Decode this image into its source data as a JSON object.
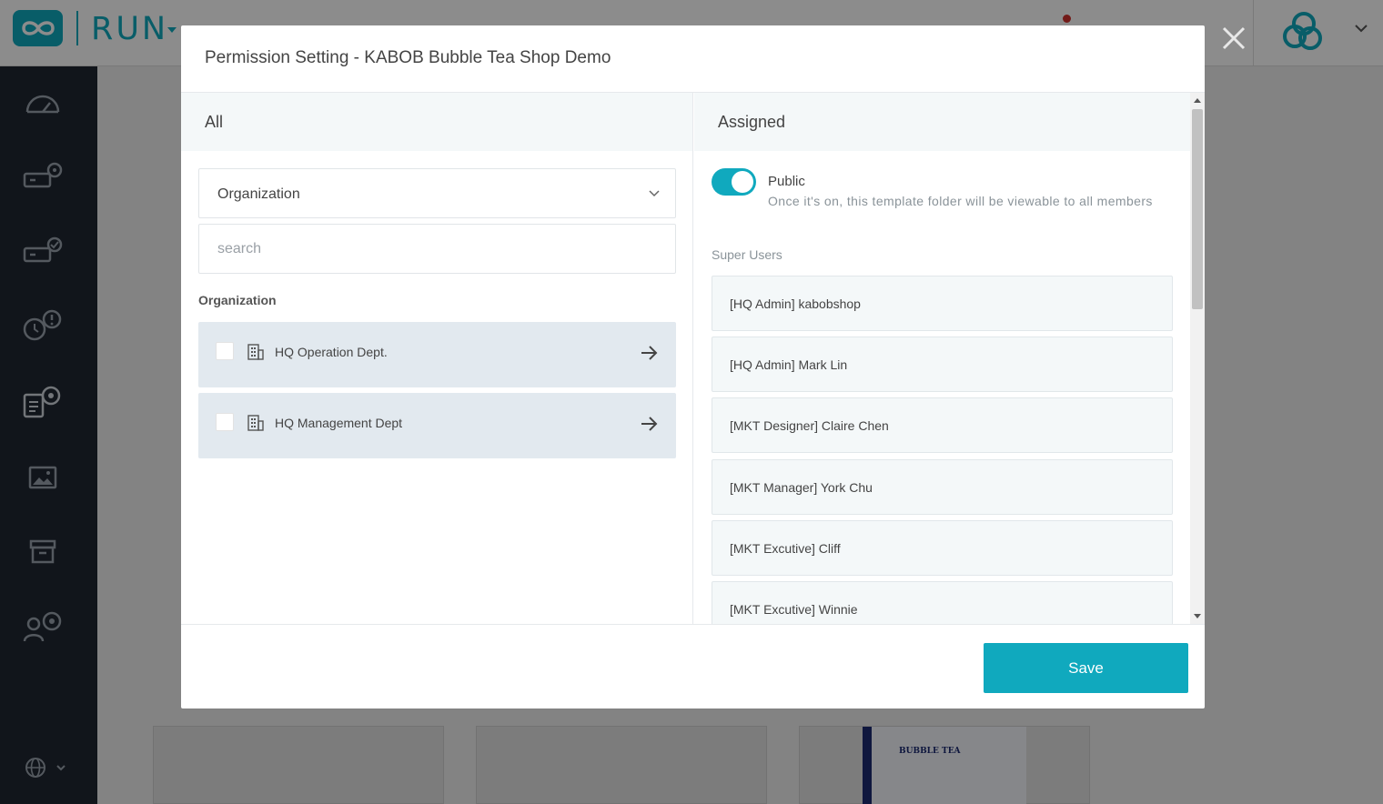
{
  "app": {
    "logo_text": "RUN",
    "accent_color": "#10a9be",
    "sidebar_color": "#1f2732"
  },
  "sidebar": {
    "icons": [
      "dashboard-gauge-icon",
      "device-settings-icon",
      "device-check-icon",
      "alert-schedule-icon",
      "template-settings-icon",
      "media-image-icon",
      "archive-box-icon",
      "user-settings-icon"
    ],
    "bottom_icon": "globe-icon"
  },
  "background": {
    "poster_title": "BUBBLE TEA"
  },
  "modal": {
    "title": "Permission Setting - KABOB Bubble Tea Shop Demo",
    "left": {
      "heading": "All",
      "select_value": "Organization",
      "search_placeholder": "search",
      "section_label": "Organization",
      "items": [
        {
          "label": "HQ Operation Dept.",
          "checked": false
        },
        {
          "label": "HQ Management Dept",
          "checked": false
        }
      ]
    },
    "right": {
      "heading": "Assigned",
      "public_toggle": {
        "label": "Public",
        "on": true,
        "description": "Once it's on, this template folder will be viewable to all members"
      },
      "super_users_label": "Super Users",
      "users": [
        "[HQ Admin] kabobshop",
        "[HQ Admin] Mark Lin",
        "[MKT Designer] Claire Chen",
        "[MKT Manager] York Chu",
        "[MKT Excutive] Cliff",
        "[MKT Excutive] Winnie"
      ]
    },
    "save_label": "Save"
  }
}
